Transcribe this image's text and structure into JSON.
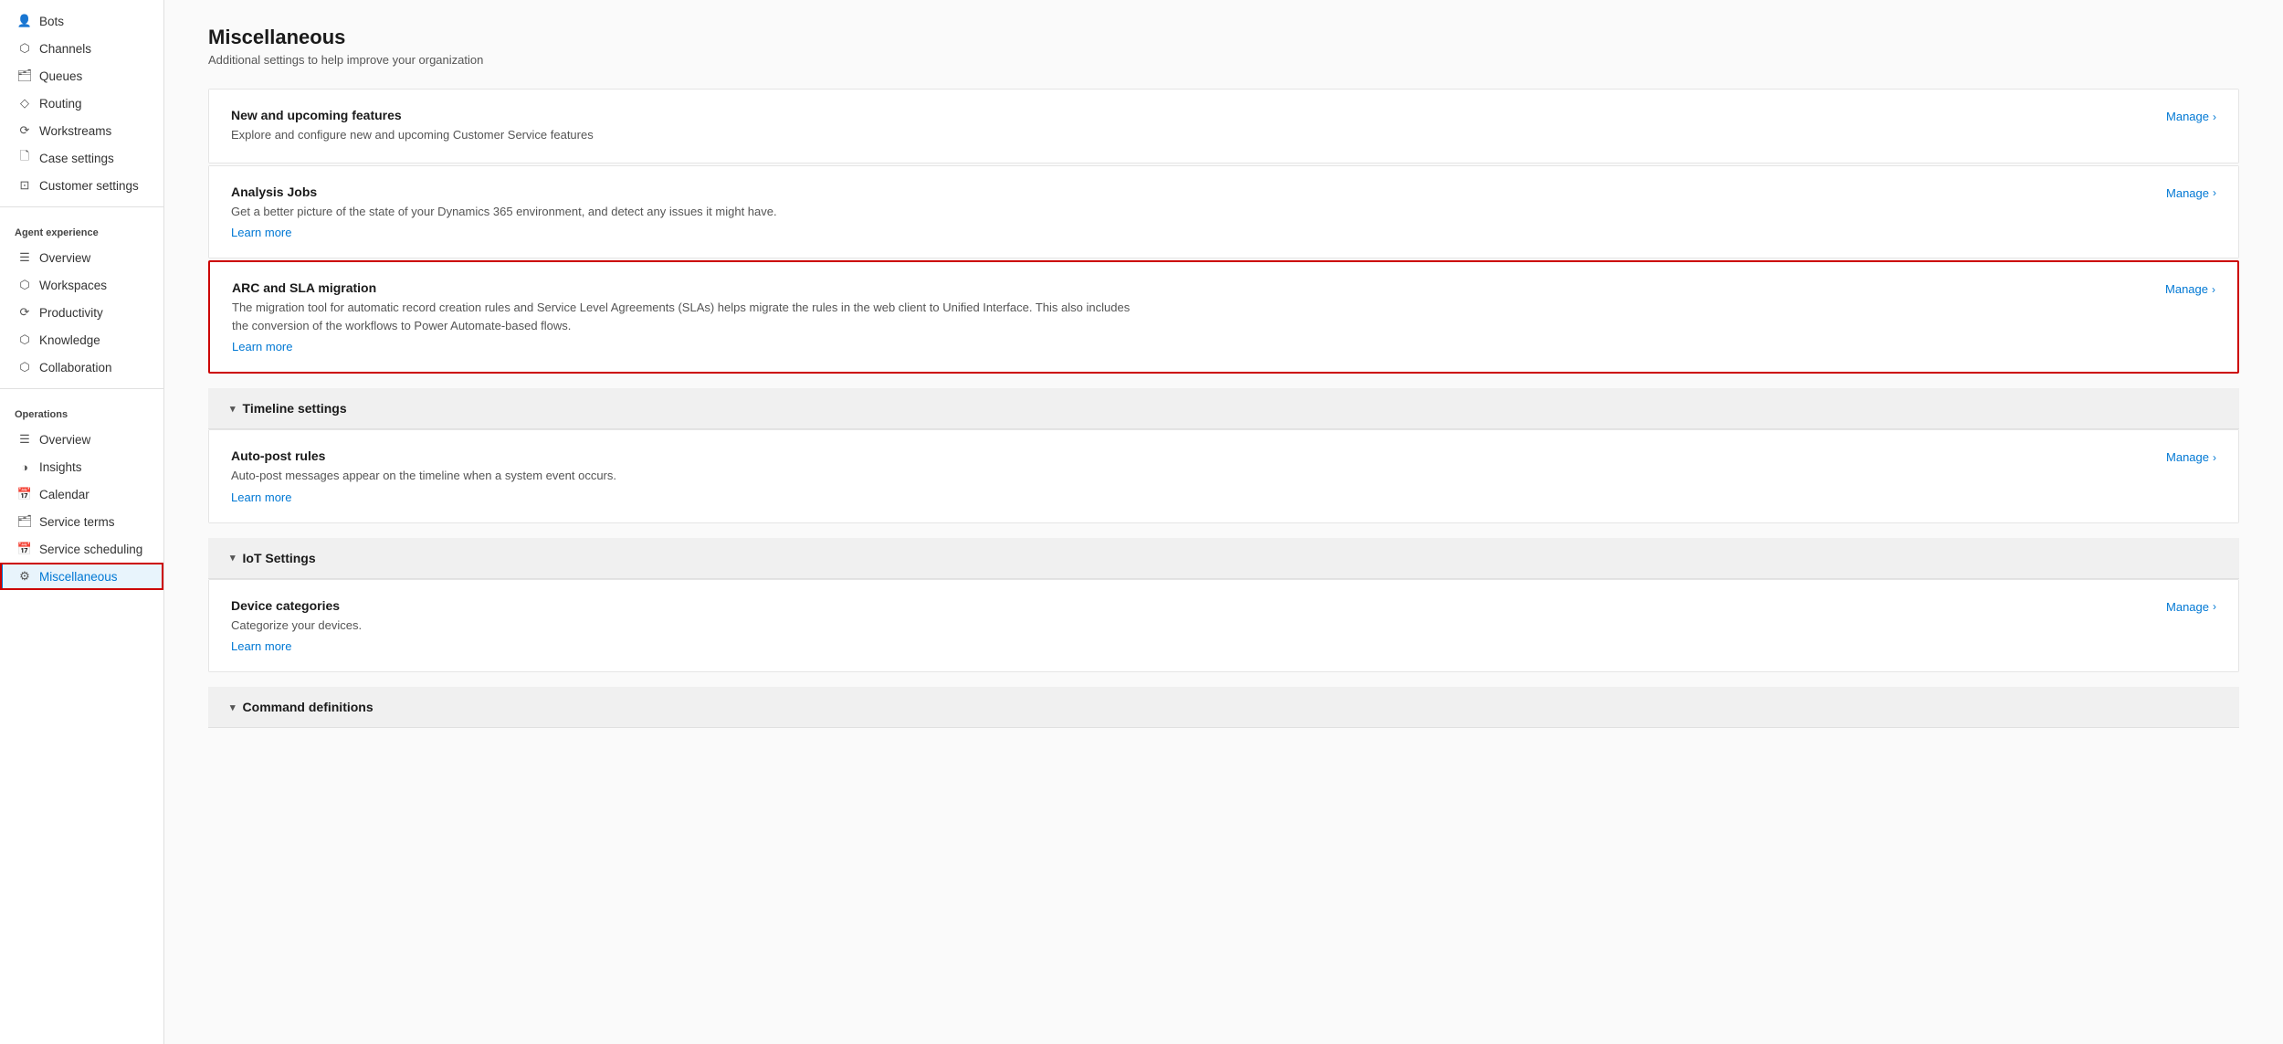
{
  "sidebar": {
    "sections": [
      {
        "items": [
          {
            "id": "bots",
            "label": "Bots",
            "icon": "👤"
          },
          {
            "id": "channels",
            "label": "Channels",
            "icon": "⬡"
          },
          {
            "id": "queues",
            "label": "Queues",
            "icon": "🖂"
          },
          {
            "id": "routing",
            "label": "Routing",
            "icon": "◇"
          },
          {
            "id": "workstreams",
            "label": "Workstreams",
            "icon": "⟳"
          },
          {
            "id": "case-settings",
            "label": "Case settings",
            "icon": "🗋"
          },
          {
            "id": "customer-settings",
            "label": "Customer settings",
            "icon": "⊡"
          }
        ]
      },
      {
        "header": "Agent experience",
        "items": [
          {
            "id": "agent-overview",
            "label": "Overview",
            "icon": "☰"
          },
          {
            "id": "workspaces",
            "label": "Workspaces",
            "icon": "⬡"
          },
          {
            "id": "productivity",
            "label": "Productivity",
            "icon": "⟳"
          },
          {
            "id": "knowledge",
            "label": "Knowledge",
            "icon": "⬡"
          },
          {
            "id": "collaboration",
            "label": "Collaboration",
            "icon": "⬡"
          }
        ]
      },
      {
        "header": "Operations",
        "items": [
          {
            "id": "ops-overview",
            "label": "Overview",
            "icon": "☰"
          },
          {
            "id": "insights",
            "label": "Insights",
            "icon": "◑"
          },
          {
            "id": "calendar",
            "label": "Calendar",
            "icon": "📅"
          },
          {
            "id": "service-terms",
            "label": "Service terms",
            "icon": "🖂"
          },
          {
            "id": "service-scheduling",
            "label": "Service scheduling",
            "icon": "📅"
          },
          {
            "id": "miscellaneous",
            "label": "Miscellaneous",
            "icon": "⚙",
            "active": true
          }
        ]
      }
    ]
  },
  "main": {
    "title": "Miscellaneous",
    "subtitle": "Additional settings to help improve your organization",
    "rows": [
      {
        "id": "new-upcoming-features",
        "title": "New and upcoming features",
        "desc": "Explore and configure new and upcoming Customer Service features",
        "manage_label": "Manage",
        "has_learn_more": false,
        "highlighted": false
      },
      {
        "id": "analysis-jobs",
        "title": "Analysis Jobs",
        "desc": "Get a better picture of the state of your Dynamics 365 environment, and detect any issues it might have.",
        "learn_more": "Learn more",
        "manage_label": "Manage",
        "highlighted": false
      },
      {
        "id": "arc-sla-migration",
        "title": "ARC and SLA migration",
        "desc": "The migration tool for automatic record creation rules and Service Level Agreements (SLAs) helps migrate the rules in the web client to Unified Interface. This also includes the conversion of the workflows to Power Automate-based flows.",
        "learn_more": "Learn more",
        "manage_label": "Manage",
        "highlighted": true
      }
    ],
    "sections": [
      {
        "id": "timeline-settings",
        "label": "Timeline settings",
        "rows": [
          {
            "id": "auto-post-rules",
            "title": "Auto-post rules",
            "desc": "Auto-post messages appear on the timeline when a system event occurs.",
            "learn_more": "Learn more",
            "manage_label": "Manage"
          }
        ]
      },
      {
        "id": "iot-settings",
        "label": "IoT Settings",
        "rows": [
          {
            "id": "device-categories",
            "title": "Device categories",
            "desc": "Categorize your devices.",
            "learn_more": "Learn more",
            "manage_label": "Manage"
          }
        ]
      },
      {
        "id": "command-definitions",
        "label": "Command definitions",
        "rows": []
      }
    ]
  }
}
